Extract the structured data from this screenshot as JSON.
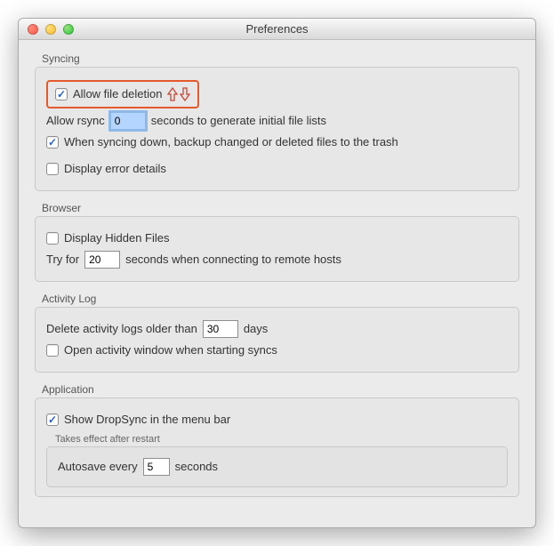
{
  "window": {
    "title": "Preferences"
  },
  "syncing": {
    "legend": "Syncing",
    "allow_file_deletion": "Allow file deletion",
    "allow_rsync_prefix": "Allow rsync",
    "allow_rsync_value": "0",
    "allow_rsync_suffix": "seconds to generate initial file lists",
    "backup_to_trash": "When syncing down, backup changed or deleted files to the trash",
    "display_error_details": "Display error details"
  },
  "browser": {
    "legend": "Browser",
    "display_hidden": "Display Hidden Files",
    "try_for_prefix": "Try for",
    "try_for_value": "20",
    "try_for_suffix": "seconds when connecting to remote hosts"
  },
  "activity": {
    "legend": "Activity Log",
    "delete_prefix": "Delete activity logs older than",
    "delete_value": "30",
    "delete_suffix": "days",
    "open_on_start": "Open activity window when starting syncs"
  },
  "application": {
    "legend": "Application",
    "show_menubar": "Show DropSync in the menu bar",
    "restart_note": "Takes effect after restart",
    "autosave_prefix": "Autosave every",
    "autosave_value": "5",
    "autosave_suffix": "seconds"
  }
}
